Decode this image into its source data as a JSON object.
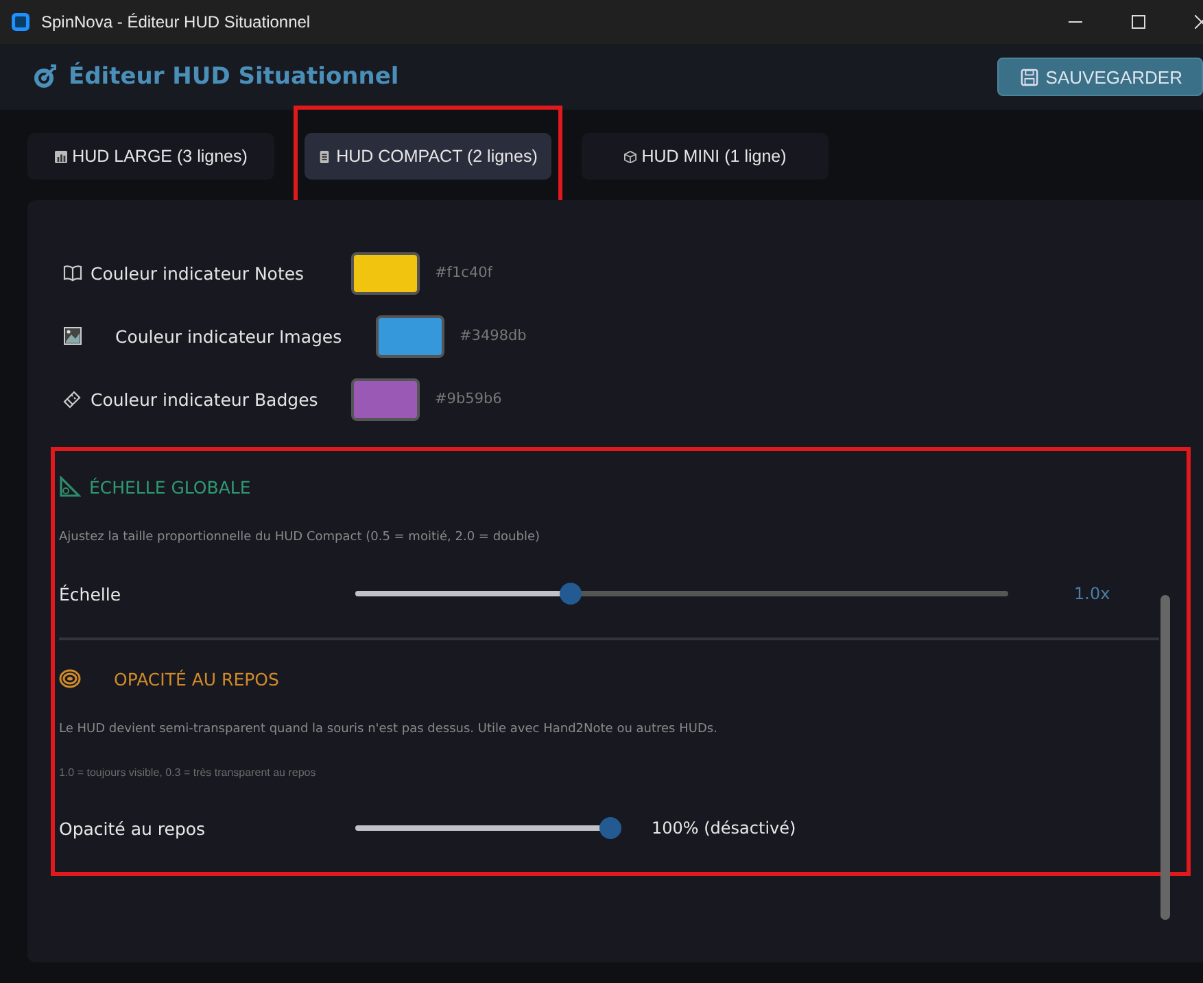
{
  "window": {
    "title": "SpinNova - Éditeur HUD Situationnel"
  },
  "header": {
    "title": "Éditeur HUD Situationnel",
    "save_button": "SAUVEGARDER"
  },
  "tabs": [
    {
      "label": "HUD LARGE (3 lignes)",
      "selected": false,
      "highlighted": false
    },
    {
      "label": "HUD COMPACT (2 lignes)",
      "selected": true,
      "highlighted": true
    },
    {
      "label": "HUD MINI (1 ligne)",
      "selected": false,
      "highlighted": false
    }
  ],
  "colors": [
    {
      "label": "Couleur indicateur Notes",
      "color": "#f1c40f",
      "value": "#f1c40f"
    },
    {
      "label": "Couleur indicateur Images",
      "color": "#3498db",
      "value": "#3498db"
    },
    {
      "label": "Couleur indicateur Badges",
      "color": "#9b59b6",
      "value": "#9b59b6"
    }
  ],
  "settings_group": {
    "highlighted": true
  },
  "scale": {
    "title": "ÉCHELLE GLOBALE",
    "description": "Ajustez la taille proportionnelle du HUD Compact (0.5 = moitié, 2.0 = double)",
    "label": "Échelle",
    "level": 0.33,
    "reading": "1.0x"
  },
  "opacity": {
    "title": "OPACITÉ AU REPOS",
    "description": "Le HUD devient semi-transparent quand la souris n'est pas dessus. Utile avec Hand2Note ou autres HUDs.",
    "note": "1.0 = toujours visible, 0.3 = très transparent au repos",
    "label": "Opacité au repos",
    "level": 1,
    "reading": "100% (désactivé)"
  }
}
